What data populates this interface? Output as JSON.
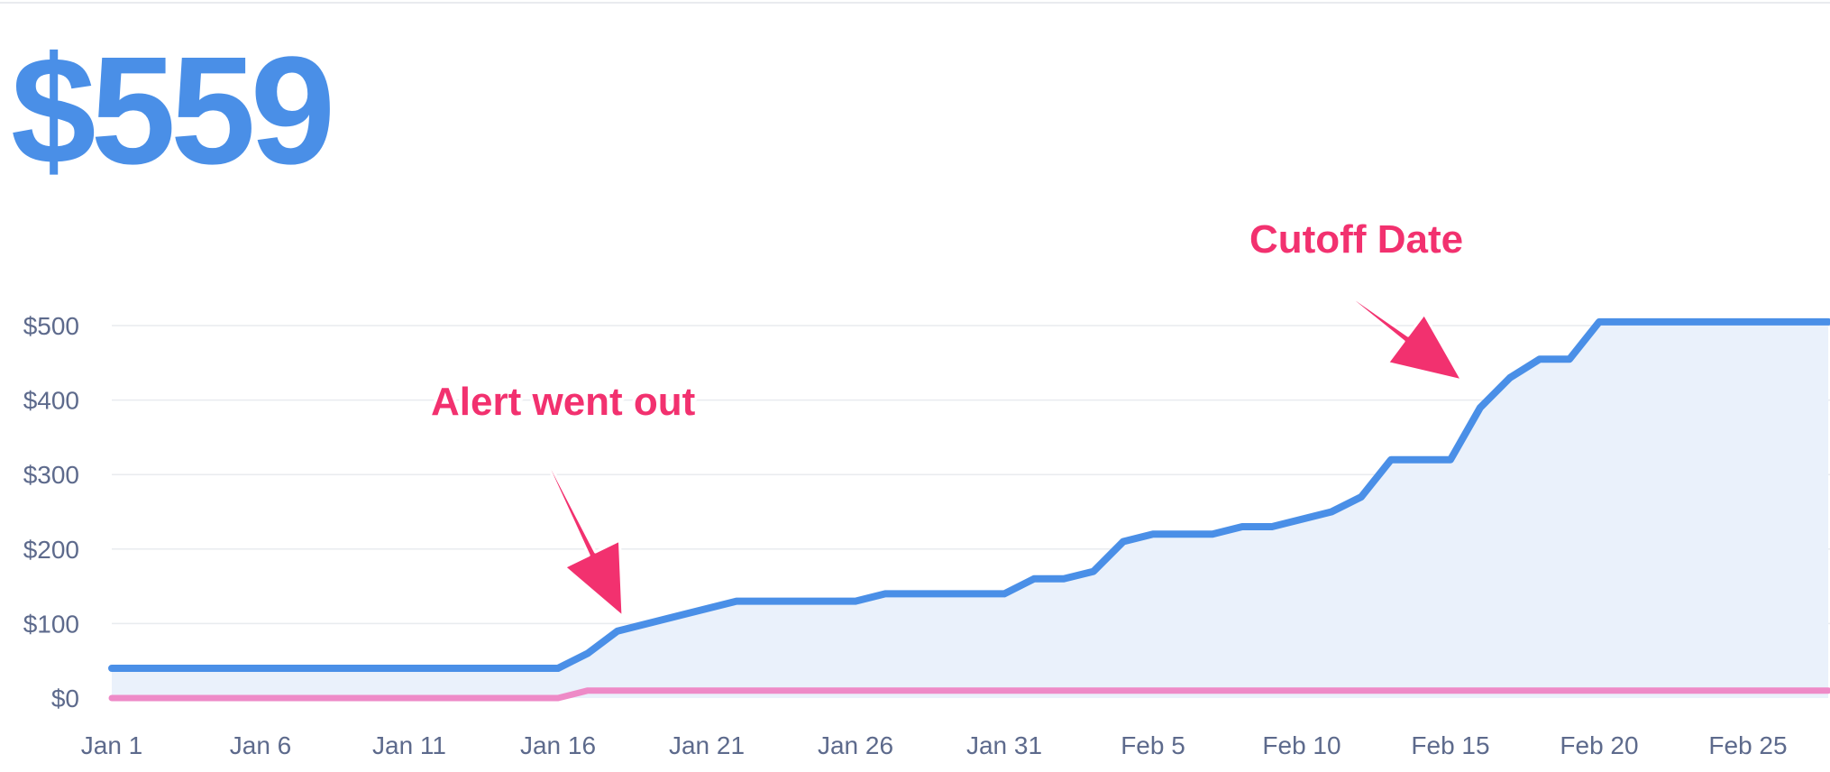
{
  "headline": {
    "total": "$559"
  },
  "colors": {
    "primary": "#4a8fe7",
    "area": "#eaf1fb",
    "secondary": "#ee8ac7",
    "annotation": "#f2316f",
    "grid": "#e9ebef",
    "tick": "#5d6a8c"
  },
  "chart_data": {
    "type": "area",
    "x_unit": "days since Jan 1",
    "xlim": [
      0,
      57.7
    ],
    "ylim": [
      0,
      500
    ],
    "yticks": [
      {
        "value": 0,
        "label": "$0"
      },
      {
        "value": 100,
        "label": "$100"
      },
      {
        "value": 200,
        "label": "$200"
      },
      {
        "value": 300,
        "label": "$300"
      },
      {
        "value": 400,
        "label": "$400"
      },
      {
        "value": 500,
        "label": "$500"
      }
    ],
    "xticks": [
      {
        "value": 0,
        "label": "Jan 1"
      },
      {
        "value": 5,
        "label": "Jan 6"
      },
      {
        "value": 10,
        "label": "Jan 11"
      },
      {
        "value": 15,
        "label": "Jan 16"
      },
      {
        "value": 20,
        "label": "Jan 21"
      },
      {
        "value": 25,
        "label": "Jan 26"
      },
      {
        "value": 30,
        "label": "Jan 31"
      },
      {
        "value": 35,
        "label": "Feb 5"
      },
      {
        "value": 40,
        "label": "Feb 10"
      },
      {
        "value": 45,
        "label": "Feb 15"
      },
      {
        "value": 50,
        "label": "Feb 20"
      },
      {
        "value": 55,
        "label": "Feb 25"
      }
    ],
    "grid": true,
    "series": [
      {
        "name": "",
        "color": "#4a8fe7",
        "fill": true,
        "points": [
          [
            0,
            40
          ],
          [
            15,
            40
          ],
          [
            16,
            60
          ],
          [
            17,
            90
          ],
          [
            20,
            120
          ],
          [
            21,
            130
          ],
          [
            24,
            130
          ],
          [
            25,
            130
          ],
          [
            26,
            140
          ],
          [
            30,
            140
          ],
          [
            31,
            160
          ],
          [
            32,
            160
          ],
          [
            33,
            170
          ],
          [
            34,
            210
          ],
          [
            35,
            220
          ],
          [
            37,
            220
          ],
          [
            38,
            230
          ],
          [
            39,
            230
          ],
          [
            41,
            250
          ],
          [
            42,
            270
          ],
          [
            43,
            320
          ],
          [
            45,
            320
          ],
          [
            46,
            390
          ],
          [
            47,
            430
          ],
          [
            48,
            455
          ],
          [
            49,
            455
          ],
          [
            50,
            505
          ],
          [
            57.7,
            505
          ]
        ]
      },
      {
        "name": "",
        "color": "#ee8ac7",
        "fill": false,
        "points": [
          [
            0,
            0
          ],
          [
            15,
            0
          ],
          [
            16,
            10
          ],
          [
            57.7,
            10
          ]
        ]
      }
    ],
    "annotations": [
      {
        "text": "Alert went out",
        "x": 17,
        "y": 90
      },
      {
        "text": "Cutoff Date",
        "x": 46,
        "y": 420
      }
    ]
  }
}
